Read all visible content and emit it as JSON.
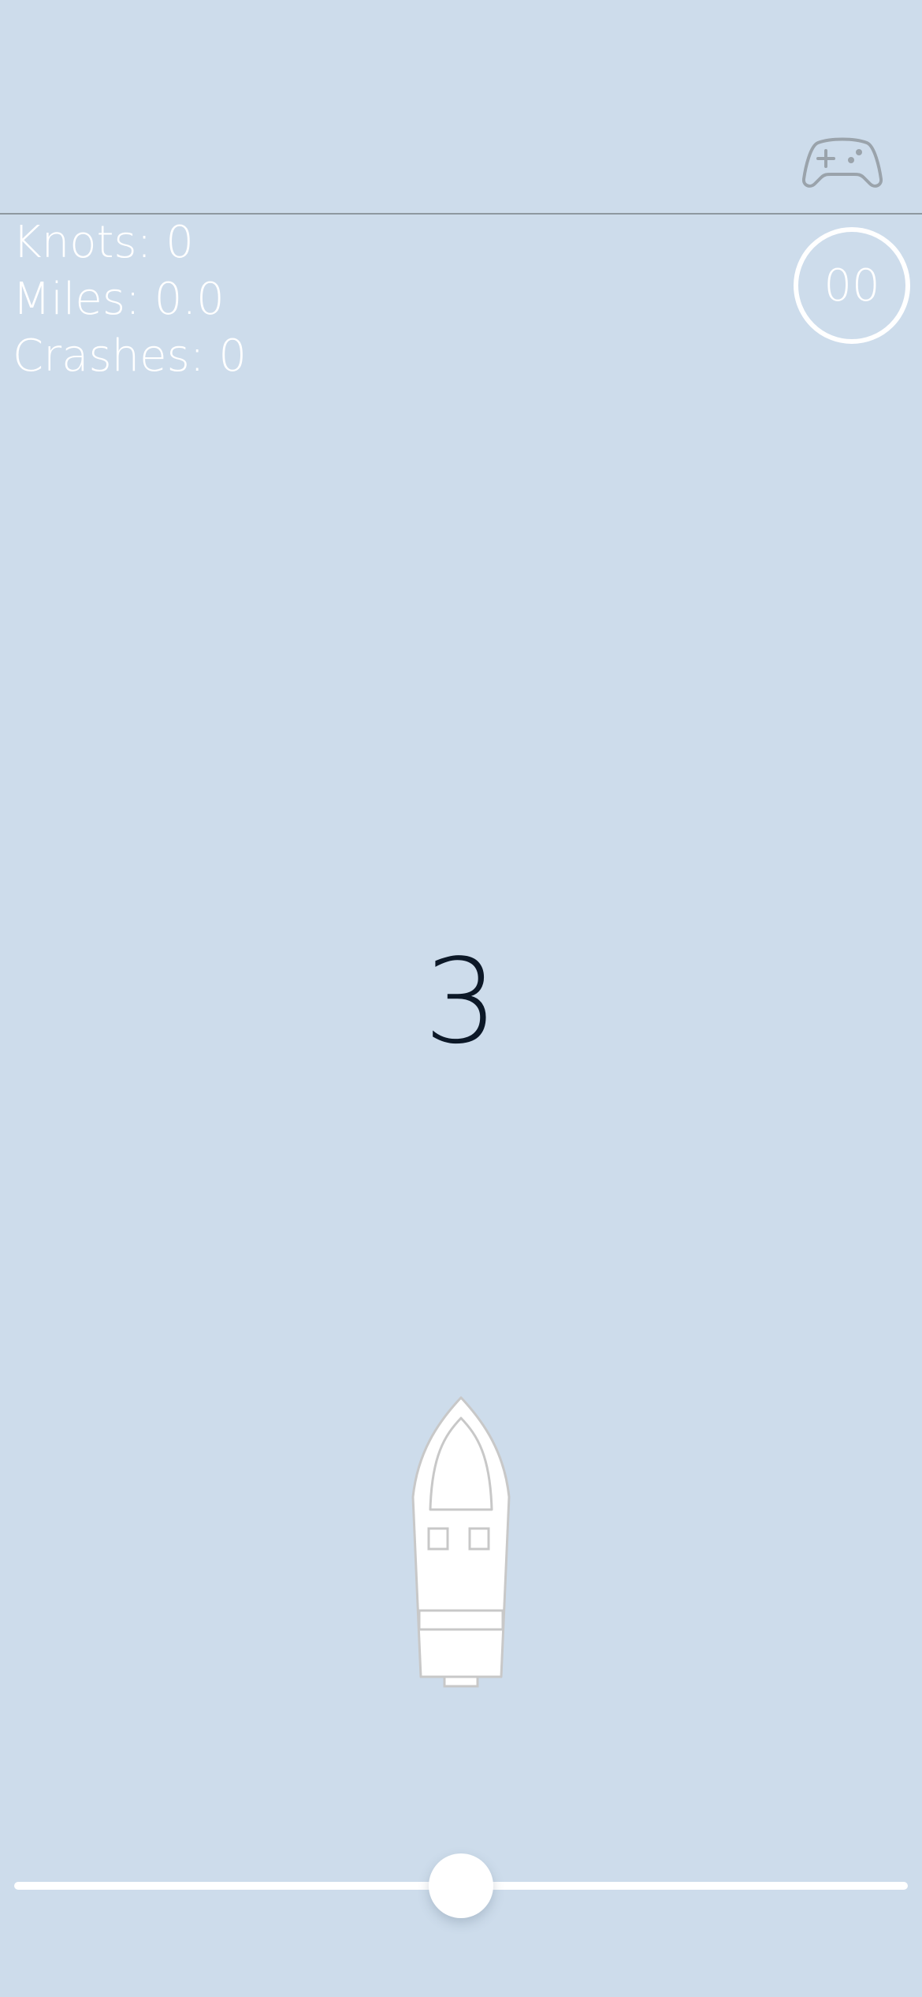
{
  "hud": {
    "knots_label": "Knots: 0",
    "miles_label": "Miles: 0.0",
    "crashes_label": "Crashes: 0",
    "timer": "00",
    "controller_icon": "gamepad-icon"
  },
  "countdown": "3",
  "steering": {
    "value": 0.5
  },
  "colors": {
    "water": "#cddceb",
    "hud_text": "#ffffff",
    "countdown_text": "#0c1827",
    "divider": "#8e98a0",
    "boat_fill": "#ffffff",
    "boat_outline": "#c8c8c8"
  }
}
